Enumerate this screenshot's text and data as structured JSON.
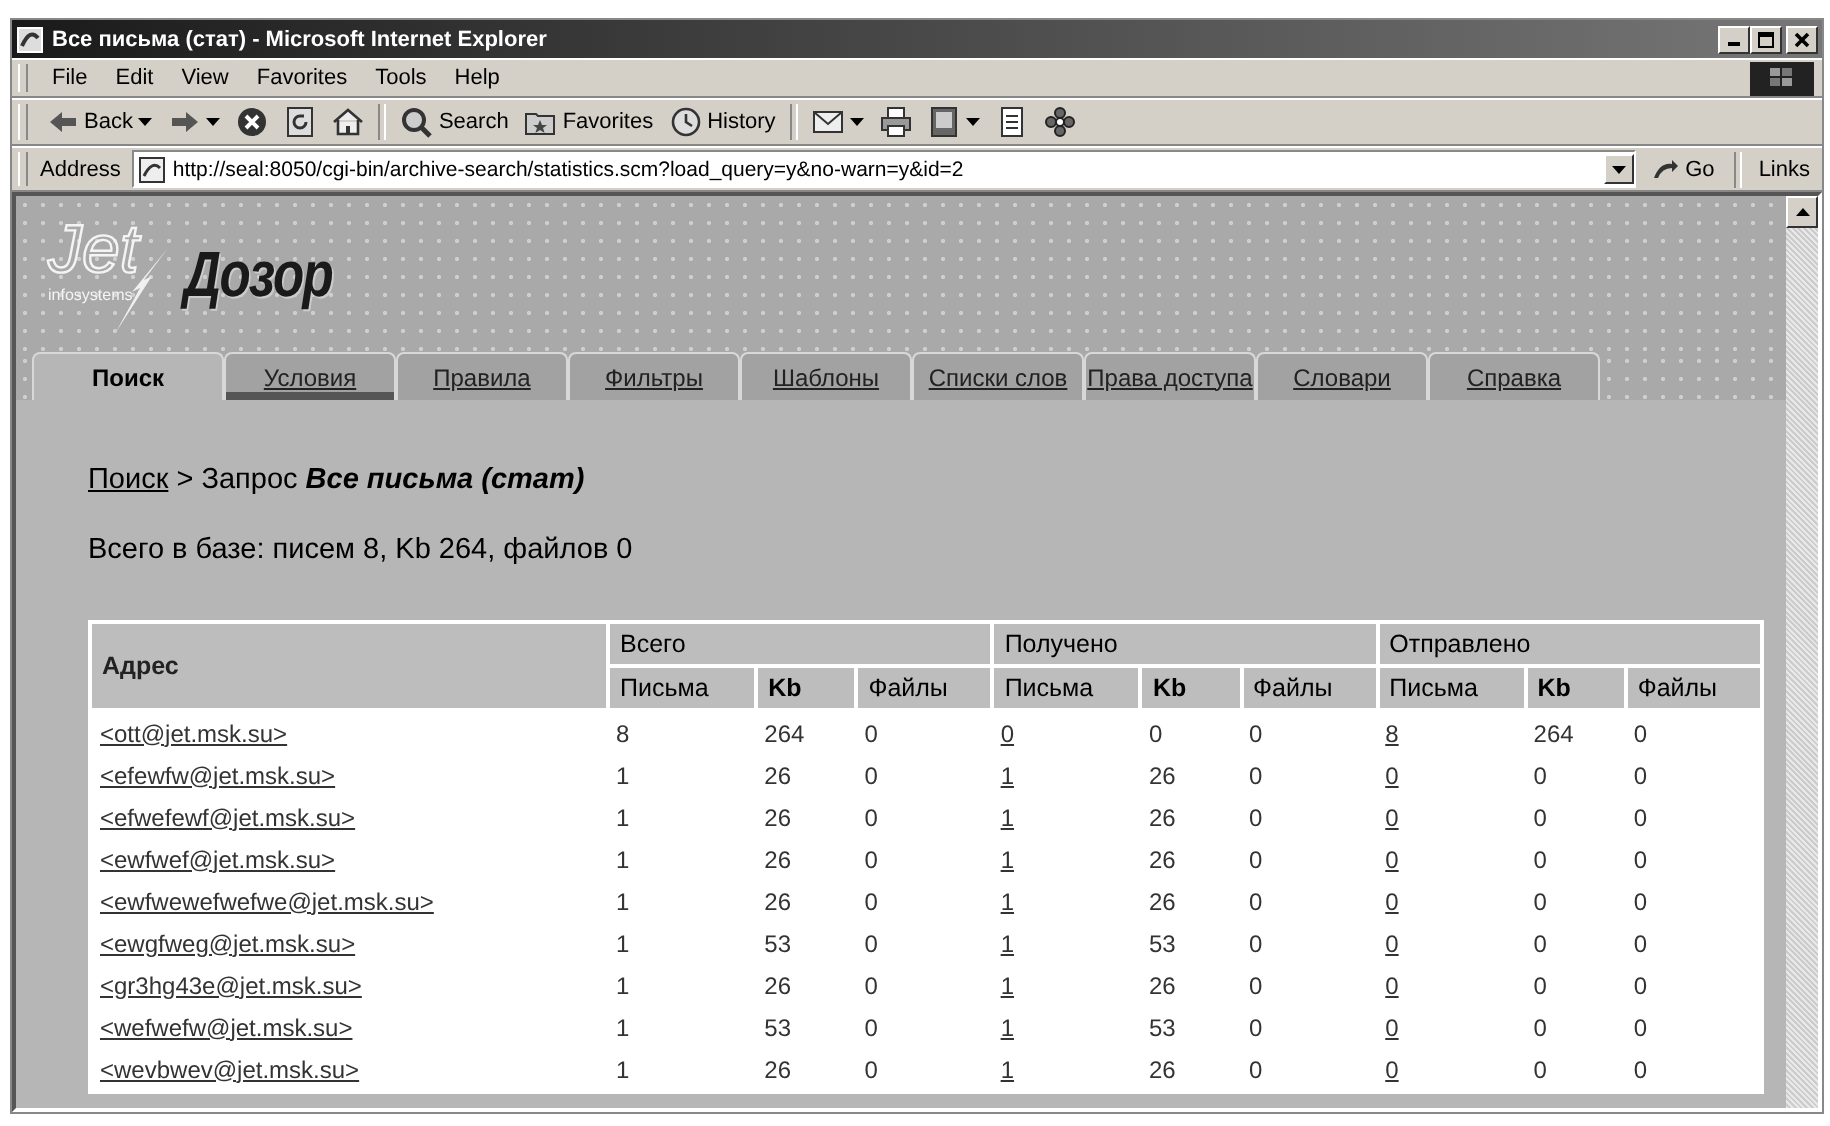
{
  "window": {
    "title": "Все письма (стат) - Microsoft Internet Explorer"
  },
  "menu": [
    {
      "label": "File"
    },
    {
      "label": "Edit"
    },
    {
      "label": "View"
    },
    {
      "label": "Favorites"
    },
    {
      "label": "Tools"
    },
    {
      "label": "Help"
    }
  ],
  "toolbar": [
    {
      "kind": "back",
      "label": "Back",
      "dropdown": true
    },
    {
      "kind": "forward",
      "dropdown": true
    },
    {
      "kind": "stop",
      "dropdown": false
    },
    {
      "kind": "refresh",
      "dropdown": false
    },
    {
      "kind": "home",
      "dropdown": false
    },
    {
      "kind": "search",
      "label": "Search",
      "dropdown": false
    },
    {
      "kind": "favorites",
      "label": "Favorites",
      "dropdown": false
    },
    {
      "kind": "history",
      "label": "History",
      "dropdown": false
    },
    {
      "kind": "mail",
      "dropdown": true
    },
    {
      "kind": "print",
      "dropdown": false
    },
    {
      "kind": "edit",
      "dropdown": true
    },
    {
      "kind": "discuss",
      "dropdown": false
    },
    {
      "kind": "messenger",
      "dropdown": false
    }
  ],
  "address": {
    "label": "Address",
    "value": "http://seal:8050/cgi-bin/archive-search/statistics.scm?load_query=y&no-warn=y&id=2",
    "go": "Go",
    "links": "Links"
  },
  "logo": {
    "jet": "Jet",
    "company": "infosystems",
    "product": "Дозор"
  },
  "tabs": [
    {
      "label": "Поиск",
      "selected": true,
      "hover": false
    },
    {
      "label": "Условия",
      "selected": false,
      "hover": true
    },
    {
      "label": "Правила",
      "selected": false,
      "hover": false
    },
    {
      "label": "Фильтры",
      "selected": false,
      "hover": false
    },
    {
      "label": "Шаблоны",
      "selected": false,
      "hover": false
    },
    {
      "label": "Списки слов",
      "selected": false,
      "hover": false
    },
    {
      "label": "Права доступа",
      "selected": false,
      "hover": false
    },
    {
      "label": "Словари",
      "selected": false,
      "hover": false
    },
    {
      "label": "Справка",
      "selected": false,
      "hover": false
    }
  ],
  "breadcrumb": {
    "link": "Поиск",
    "separator": ">",
    "label": "Запрос",
    "query": "Все письма (стат)"
  },
  "summary": "Всего в базе: писем 8, Kb 264, файлов 0",
  "table": {
    "address_header": "Адрес",
    "groups": [
      {
        "title": "Всего",
        "columns": [
          {
            "label": "Письма",
            "kind": "text"
          },
          {
            "label": "Kb",
            "kind": "text"
          },
          {
            "label": "Файлы",
            "kind": "text"
          }
        ]
      },
      {
        "title": "Получено",
        "columns": [
          {
            "label": "Письма",
            "kind": "link"
          },
          {
            "label": "Kb",
            "kind": "text"
          },
          {
            "label": "Файлы",
            "kind": "text"
          }
        ]
      },
      {
        "title": "Отправлено",
        "columns": [
          {
            "label": "Письма",
            "kind": "link"
          },
          {
            "label": "Kb",
            "kind": "text"
          },
          {
            "label": "Файлы",
            "kind": "text"
          }
        ]
      }
    ],
    "rows": [
      {
        "address": "<ott@jet.msk.su>",
        "cells": [
          "8",
          "264",
          "0",
          "0",
          "0",
          "0",
          "8",
          "264",
          "0"
        ]
      },
      {
        "address": "<efewfw@jet.msk.su>",
        "cells": [
          "1",
          "26",
          "0",
          "1",
          "26",
          "0",
          "0",
          "0",
          "0"
        ]
      },
      {
        "address": "<efwefewf@jet.msk.su>",
        "cells": [
          "1",
          "26",
          "0",
          "1",
          "26",
          "0",
          "0",
          "0",
          "0"
        ]
      },
      {
        "address": "<ewfwef@jet.msk.su>",
        "cells": [
          "1",
          "26",
          "0",
          "1",
          "26",
          "0",
          "0",
          "0",
          "0"
        ]
      },
      {
        "address": "<ewfwewefwefwe@jet.msk.su>",
        "cells": [
          "1",
          "26",
          "0",
          "1",
          "26",
          "0",
          "0",
          "0",
          "0"
        ]
      },
      {
        "address": "<ewgfweg@jet.msk.su>",
        "cells": [
          "1",
          "53",
          "0",
          "1",
          "53",
          "0",
          "0",
          "0",
          "0"
        ]
      },
      {
        "address": "<gr3hg43e@jet.msk.su>",
        "cells": [
          "1",
          "26",
          "0",
          "1",
          "26",
          "0",
          "0",
          "0",
          "0"
        ]
      },
      {
        "address": "<wefwefw@jet.msk.su>",
        "cells": [
          "1",
          "53",
          "0",
          "1",
          "53",
          "0",
          "0",
          "0",
          "0"
        ]
      },
      {
        "address": "<wevbwev@jet.msk.su>",
        "cells": [
          "1",
          "26",
          "0",
          "1",
          "26",
          "0",
          "0",
          "0",
          "0"
        ]
      }
    ]
  }
}
